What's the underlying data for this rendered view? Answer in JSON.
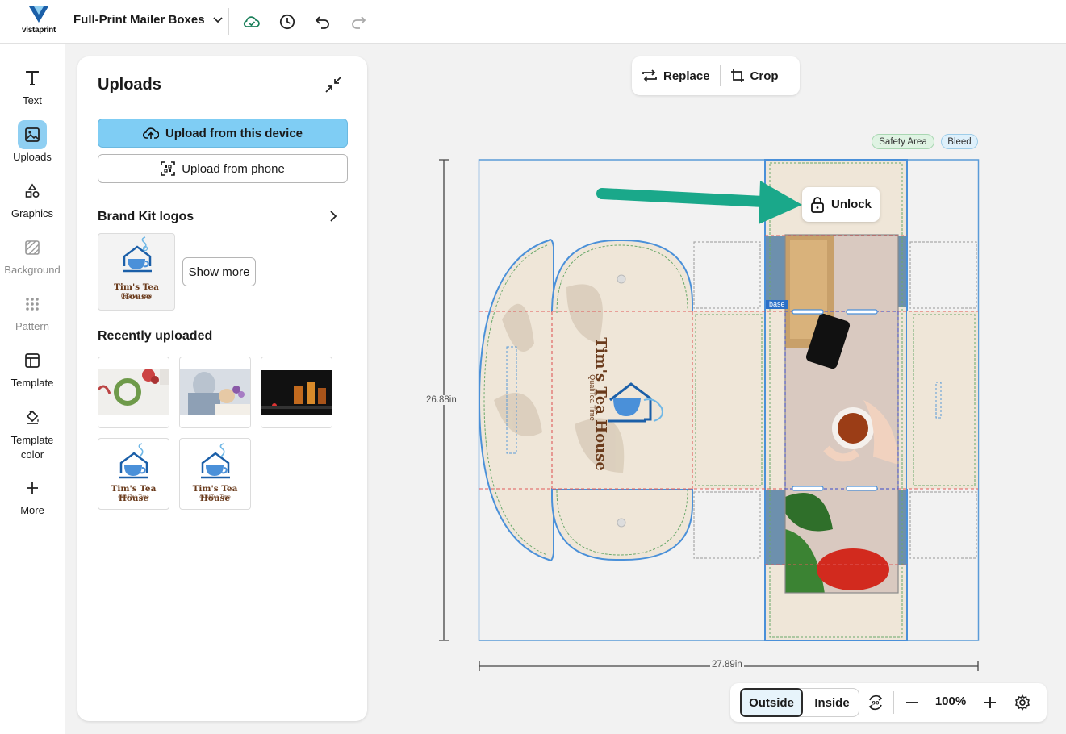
{
  "app": {
    "logo_text": "vistaprint",
    "document_title": "Full-Print Mailer Boxes"
  },
  "rail": [
    {
      "label": "Text",
      "icon": "text-icon",
      "state": "normal"
    },
    {
      "label": "Uploads",
      "icon": "image-icon",
      "state": "active"
    },
    {
      "label": "Graphics",
      "icon": "shapes-icon",
      "state": "normal"
    },
    {
      "label": "Background",
      "icon": "background-icon",
      "state": "disabled"
    },
    {
      "label": "Pattern",
      "icon": "pattern-icon",
      "state": "disabled"
    },
    {
      "label": "Template",
      "icon": "template-icon",
      "state": "normal"
    },
    {
      "label": "Template color",
      "icon": "paint-bucket-icon",
      "state": "normal"
    },
    {
      "label": "More",
      "icon": "plus-icon",
      "state": "normal"
    }
  ],
  "panel": {
    "title": "Uploads",
    "upload_device": "Upload from this device",
    "upload_phone": "Upload from phone",
    "brand_kit_heading": "Brand Kit logos",
    "show_more": "Show more",
    "recent_heading": "Recently uploaded",
    "brand_name": "Tim's Tea House",
    "brand_tagline": "QualiTea Time"
  },
  "toolbox": {
    "replace": "Replace",
    "crop": "Crop"
  },
  "legend": {
    "safety": "Safety Area",
    "bleed": "Bleed"
  },
  "dimensions": {
    "height": "26.88in",
    "width": "27.89in"
  },
  "canvas": {
    "unlock": "Unlock",
    "base_tag": "base",
    "box_brand": "Tim's Tea House",
    "box_tagline": "QualiTea Time"
  },
  "bottombar": {
    "outside": "Outside",
    "inside": "Inside",
    "zoom": "100%"
  },
  "colors": {
    "accent_blue": "#7fcdf4",
    "arrow_green": "#1aa88a",
    "die_line": "#4a90d9",
    "safety_red": "#e05a5a",
    "box_beige": "#efe6d8",
    "brand_brown": "#6a3b1c"
  }
}
